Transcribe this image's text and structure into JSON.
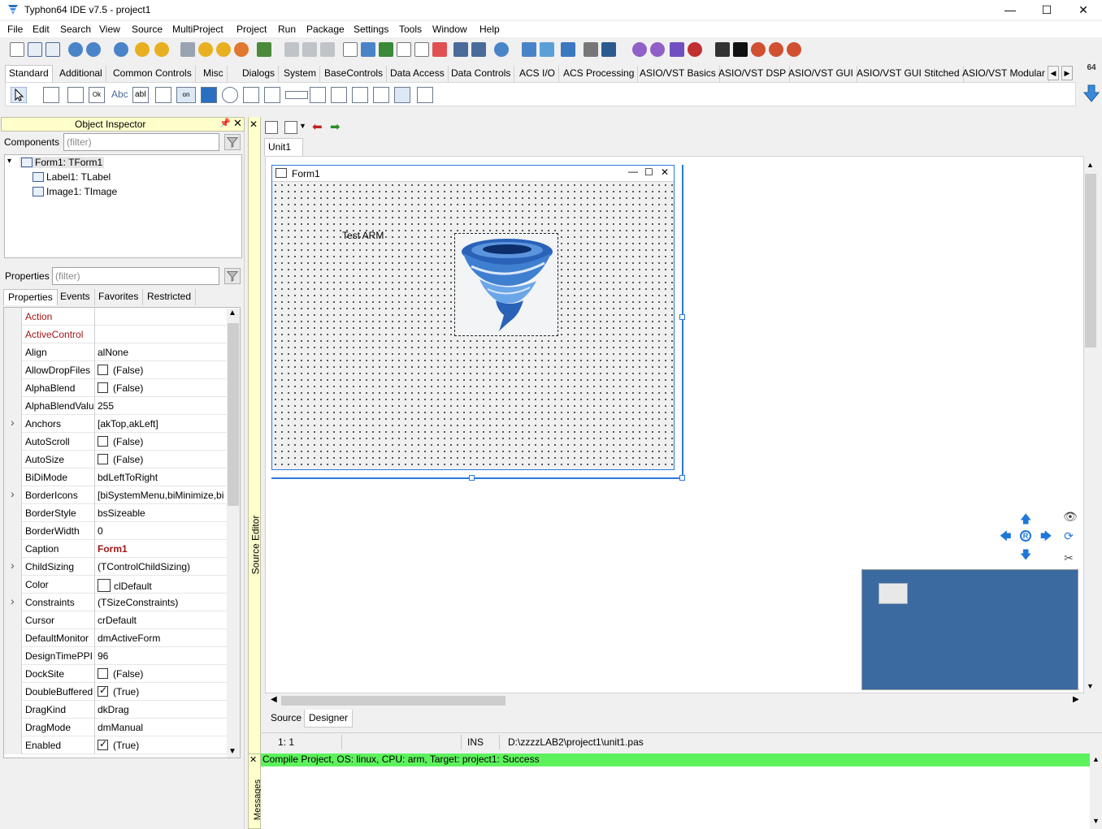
{
  "window": {
    "title": "Typhon64 IDE v7.5 - project1",
    "minimize": "—",
    "maximize": "☐",
    "close": "✕"
  },
  "menu": [
    "File",
    "Edit",
    "Search",
    "View",
    "Source",
    "MultiProject",
    "Project",
    "Run",
    "Package",
    "Settings",
    "Tools",
    "Window",
    "Help"
  ],
  "palette": {
    "tabs": [
      "Standard",
      "Additional",
      "Common Controls",
      "Misc",
      "Dialogs",
      "System",
      "BaseControls",
      "Data Access",
      "Data Controls",
      "ACS I/O",
      "ACS Processing",
      "ASIO/VST Basics",
      "ASIO/VST DSP",
      "ASIO/VST GUI",
      "ASIO/VST GUI Stitched",
      "ASIO/VST Modular"
    ],
    "active_tab": "Standard",
    "badge": "64",
    "comp_labels": [
      "Ok",
      "Abc",
      "abI",
      "on"
    ]
  },
  "inspector": {
    "title": "Object Inspector",
    "components_label": "Components",
    "components_filter_placeholder": "(filter)",
    "tree": [
      {
        "label": "Form1: TForm1",
        "level": 0
      },
      {
        "label": "Label1: TLabel",
        "level": 1
      },
      {
        "label": "Image1: TImage",
        "level": 1
      }
    ],
    "properties_label": "Properties",
    "properties_filter_placeholder": "(filter)",
    "tabs": [
      "Properties",
      "Events",
      "Favorites",
      "Restricted"
    ],
    "properties": [
      {
        "name": "Action",
        "value": "",
        "style": "ref"
      },
      {
        "name": "ActiveControl",
        "value": "",
        "style": "ref"
      },
      {
        "name": "Align",
        "value": "alNone"
      },
      {
        "name": "AllowDropFiles",
        "value": "(False)",
        "check": "off"
      },
      {
        "name": "AlphaBlend",
        "value": "(False)",
        "check": "off"
      },
      {
        "name": "AlphaBlendValu",
        "value": "255"
      },
      {
        "name": "Anchors",
        "value": "[akTop,akLeft]",
        "expand": true
      },
      {
        "name": "AutoScroll",
        "value": "(False)",
        "check": "off"
      },
      {
        "name": "AutoSize",
        "value": "(False)",
        "check": "off"
      },
      {
        "name": "BiDiMode",
        "value": "bdLeftToRight"
      },
      {
        "name": "BorderIcons",
        "value": "[biSystemMenu,biMinimize,bi",
        "expand": true
      },
      {
        "name": "BorderStyle",
        "value": "bsSizeable"
      },
      {
        "name": "BorderWidth",
        "value": "0"
      },
      {
        "name": "Caption",
        "value": "Form1",
        "bold": true
      },
      {
        "name": "ChildSizing",
        "value": "(TControlChildSizing)",
        "expand": true
      },
      {
        "name": "Color",
        "value": "clDefault",
        "swatch": true
      },
      {
        "name": "Constraints",
        "value": "(TSizeConstraints)",
        "expand": true
      },
      {
        "name": "Cursor",
        "value": "crDefault"
      },
      {
        "name": "DefaultMonitor",
        "value": "dmActiveForm"
      },
      {
        "name": "DesignTimePPI",
        "value": "96"
      },
      {
        "name": "DockSite",
        "value": "(False)",
        "check": "off"
      },
      {
        "name": "DoubleBuffered",
        "value": "(True)",
        "check": "on"
      },
      {
        "name": "DragKind",
        "value": "dkDrag"
      },
      {
        "name": "DragMode",
        "value": "dmManual"
      },
      {
        "name": "Enabled",
        "value": "(True)",
        "check": "on"
      }
    ]
  },
  "source_editor_label": "Source Editor",
  "editor": {
    "unit_tab": "Unit1",
    "form_caption": "Form1",
    "label_text": "Test ARM",
    "bottom_tabs": [
      "Source",
      "Designer"
    ],
    "active_bottom_tab": "Designer"
  },
  "status": {
    "position": "1:  1",
    "mode": "INS",
    "file": "D:\\zzzzLAB2\\project1\\unit1.pas"
  },
  "messages": {
    "label": "Messages",
    "line": "Compile Project, OS: linux, CPU: arm, Target: project1: Success",
    "success_color": "#5df25d"
  },
  "colors": {
    "accent": "#2b79d7",
    "ref_property": "#a01818",
    "minimap_bg": "#3b6aa0"
  }
}
